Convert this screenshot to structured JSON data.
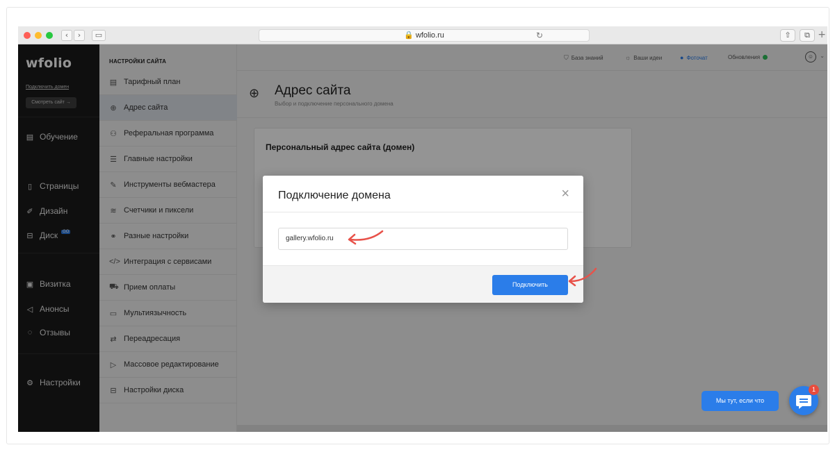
{
  "browser": {
    "url": "wfolio.ru",
    "lock_icon": "lock-icon"
  },
  "sidebar": {
    "logo": "wfolio",
    "connect_domain_link": "Подключить домен",
    "view_site_button": "Смотреть сайт →",
    "items": [
      {
        "label": "Обучение",
        "icon": "book-icon"
      },
      {
        "label": "Страницы",
        "icon": "page-icon"
      },
      {
        "label": "Дизайн",
        "icon": "brush-icon"
      },
      {
        "label": "Диск",
        "icon": "disk-icon",
        "badge": "GO"
      },
      {
        "label": "Визитка",
        "icon": "card-icon"
      },
      {
        "label": "Анонсы",
        "icon": "megaphone-icon"
      },
      {
        "label": "Отзывы",
        "icon": "reviews-icon"
      },
      {
        "label": "Настройки",
        "icon": "gear-icon"
      }
    ]
  },
  "settings_menu": {
    "heading": "НАСТРОЙКИ САЙТА",
    "items": [
      {
        "label": "Тарифный план",
        "icon": "plan-icon"
      },
      {
        "label": "Адрес сайта",
        "icon": "globe-icon",
        "active": true
      },
      {
        "label": "Реферальная программа",
        "icon": "referral-icon"
      },
      {
        "label": "Главные настройки",
        "icon": "sliders-icon"
      },
      {
        "label": "Инструменты вебмастера",
        "icon": "tools-icon"
      },
      {
        "label": "Счетчики и пиксели",
        "icon": "counters-icon"
      },
      {
        "label": "Разные настройки",
        "icon": "misc-icon"
      },
      {
        "label": "Интеграция с сервисами",
        "icon": "code-icon"
      },
      {
        "label": "Прием оплаты",
        "icon": "cart-icon"
      },
      {
        "label": "Мультиязычность",
        "icon": "language-icon"
      },
      {
        "label": "Переадресация",
        "icon": "redirect-icon"
      },
      {
        "label": "Массовое редактирование",
        "icon": "bulk-edit-icon"
      },
      {
        "label": "Настройки диска",
        "icon": "disk-settings-icon"
      }
    ]
  },
  "topbar": {
    "knowledge_base": "База знаний",
    "your_ideas": "Ваши идеи",
    "photochat": "Фоточат",
    "updates": "Обновления"
  },
  "page": {
    "title": "Адрес сайта",
    "subtitle": "Выбор и подключение персонального домена",
    "card_title": "Персональный адрес сайта (домен)"
  },
  "modal": {
    "title": "Подключение домена",
    "domain_value": "gallery.wfolio.ru",
    "connect_button": "Подключить"
  },
  "chat": {
    "pill_text": "Мы тут, если что",
    "notification_count": "1"
  },
  "colors": {
    "accent": "#2b7de9",
    "sidebar_bg": "#1b1b1b",
    "arrow": "#e8524a",
    "status_green": "#2fbf5b"
  }
}
